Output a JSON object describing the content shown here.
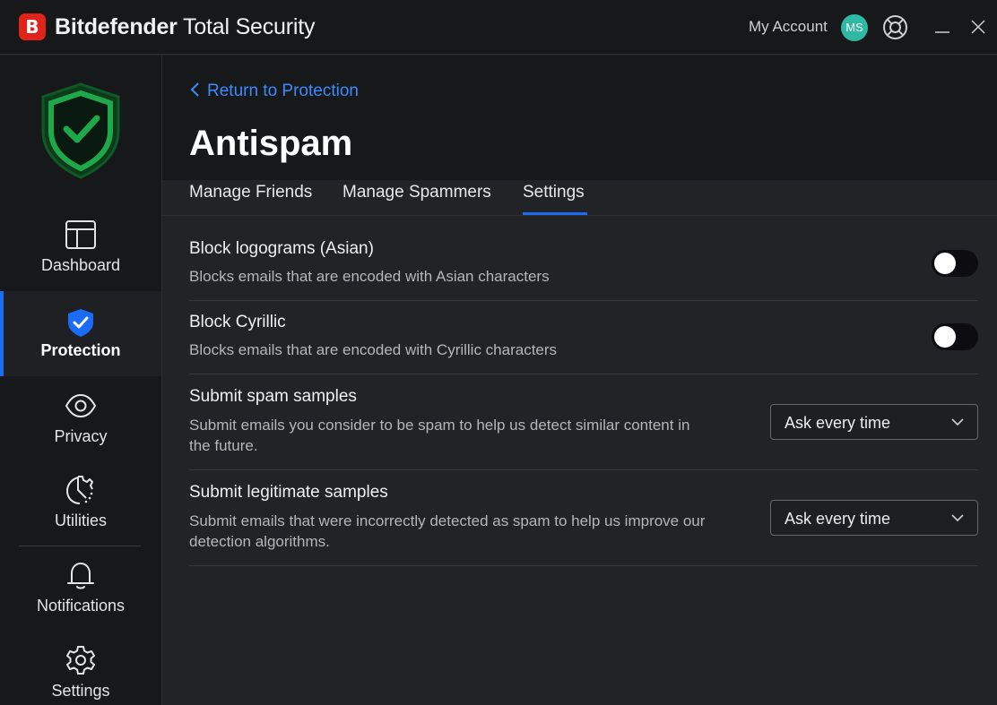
{
  "app": {
    "logo_letter": "B",
    "name_bold": "Bitdefender",
    "name_rest": " Total Security"
  },
  "titlebar": {
    "account_label": "My Account",
    "avatar_initials": "MS"
  },
  "sidebar": {
    "items": [
      {
        "label": "Dashboard",
        "icon": "dashboard-icon"
      },
      {
        "label": "Protection",
        "icon": "shield-check-icon",
        "active": true
      },
      {
        "label": "Privacy",
        "icon": "eye-icon"
      },
      {
        "label": "Utilities",
        "icon": "utilities-icon"
      },
      {
        "label": "Notifications",
        "icon": "bell-icon"
      },
      {
        "label": "Settings",
        "icon": "gear-icon"
      }
    ]
  },
  "header": {
    "back_label": "Return to Protection",
    "title": "Antispam"
  },
  "tabs": [
    {
      "label": "Manage Friends"
    },
    {
      "label": "Manage Spammers"
    },
    {
      "label": "Settings",
      "active": true
    }
  ],
  "settings": [
    {
      "title": "Block logograms (Asian)",
      "description": "Blocks emails that are encoded with Asian characters",
      "control": "toggle",
      "enabled": false
    },
    {
      "title": "Block Cyrillic",
      "description": "Blocks emails that are encoded with Cyrillic characters",
      "control": "toggle",
      "enabled": false
    },
    {
      "title": "Submit spam samples",
      "description": "Submit emails you consider to be spam to help us detect similar content in the future.",
      "control": "select",
      "value": "Ask every time"
    },
    {
      "title": "Submit legitimate samples",
      "description": "Submit emails that were incorrectly detected as spam to help us improve our detection algorithms.",
      "control": "select",
      "value": "Ask every time"
    }
  ],
  "colors": {
    "accent": "#1b6cf5",
    "link": "#3a8bff",
    "brand_red": "#e2231a",
    "shield_green": "#1fa84a",
    "avatar": "#2fb9a5"
  }
}
